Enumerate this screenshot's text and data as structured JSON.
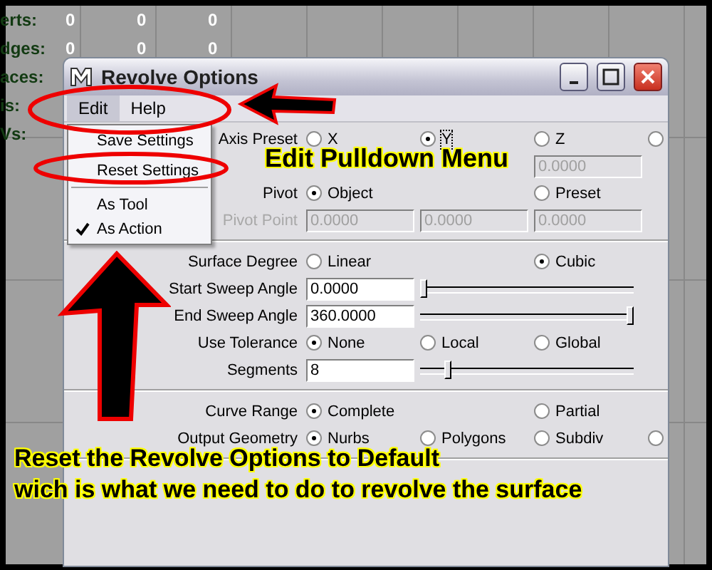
{
  "viewport_stats": [
    {
      "label": "erts:",
      "values": [
        "0",
        "0",
        "0"
      ]
    },
    {
      "label": "dges:",
      "values": [
        "0",
        "0",
        "0"
      ]
    },
    {
      "label": "aces:"
    },
    {
      "label": "is:"
    },
    {
      "label": "Vs:"
    }
  ],
  "window": {
    "title": "Revolve Options"
  },
  "menu_bar": [
    {
      "label": "Edit",
      "selected": true
    },
    {
      "label": "Help",
      "selected": false
    }
  ],
  "edit_menu": [
    {
      "kind": "item",
      "label": "Save Settings",
      "checked": false
    },
    {
      "kind": "item",
      "label": "Reset Settings",
      "checked": false
    },
    {
      "kind": "separator"
    },
    {
      "kind": "item",
      "label": "As Tool",
      "checked": false
    },
    {
      "kind": "item",
      "label": "As Action",
      "checked": true
    }
  ],
  "form": [
    {
      "kind": "radios",
      "label": "Axis Preset",
      "options": [
        {
          "kind": "radio",
          "label": "X",
          "selected": false,
          "focused": false
        },
        {
          "kind": "radio",
          "label": "Y",
          "selected": true,
          "focused": true
        },
        {
          "kind": "radio",
          "label": "Z",
          "selected": false,
          "focused": false
        },
        {
          "kind": "radio",
          "selected": false
        }
      ]
    },
    {
      "kind": "fields",
      "disabled": true,
      "fields": [
        {
          "kind": "gap"
        },
        {
          "kind": "gap"
        },
        {
          "kind": "field",
          "value": "0.0000"
        }
      ]
    },
    {
      "kind": "radios",
      "label": "Pivot",
      "options": [
        {
          "kind": "radio",
          "label": "Object",
          "selected": true,
          "focused": false
        },
        {
          "kind": "gap"
        },
        {
          "kind": "radio",
          "label": "Preset",
          "selected": false,
          "focused": false
        }
      ]
    },
    {
      "kind": "fields",
      "label": "Pivot Point",
      "disabled": true,
      "fields": [
        {
          "kind": "field",
          "value": "0.0000"
        },
        {
          "kind": "field",
          "value": "0.0000"
        },
        {
          "kind": "field",
          "value": "0.0000"
        }
      ]
    },
    {
      "kind": "separator"
    },
    {
      "kind": "radios",
      "label": "Surface Degree",
      "options": [
        {
          "kind": "radio",
          "label": "Linear",
          "selected": false,
          "focused": false
        },
        {
          "kind": "gap"
        },
        {
          "kind": "radio",
          "label": "Cubic",
          "selected": true,
          "focused": false
        }
      ]
    },
    {
      "kind": "slider",
      "label": "Start Sweep Angle",
      "value": "0.0000",
      "level": 0
    },
    {
      "kind": "slider",
      "label": "End Sweep Angle",
      "value": "360.0000",
      "level": 1
    },
    {
      "kind": "radios",
      "label": "Use Tolerance",
      "options": [
        {
          "kind": "radio",
          "label": "None",
          "selected": true,
          "focused": false
        },
        {
          "kind": "radio",
          "label": "Local",
          "selected": false,
          "focused": false
        },
        {
          "kind": "radio",
          "label": "Global",
          "selected": false,
          "focused": false
        }
      ]
    },
    {
      "kind": "slider",
      "label": "Segments",
      "value": "8",
      "level": 0.12
    },
    {
      "kind": "separator"
    },
    {
      "kind": "radios",
      "label": "Curve Range",
      "options": [
        {
          "kind": "radio",
          "label": "Complete",
          "selected": true,
          "focused": false
        },
        {
          "kind": "gap"
        },
        {
          "kind": "radio",
          "label": "Partial",
          "selected": false,
          "focused": false
        }
      ]
    },
    {
      "kind": "radios",
      "label": "Output Geometry",
      "options": [
        {
          "kind": "radio",
          "label": "Nurbs",
          "selected": true,
          "focused": false
        },
        {
          "kind": "radio",
          "label": "Polygons",
          "selected": false,
          "focused": false
        },
        {
          "kind": "radio",
          "label": "Subdiv",
          "selected": false,
          "focused": false
        },
        {
          "kind": "radio",
          "selected": false
        }
      ]
    },
    {
      "kind": "separator"
    }
  ],
  "annotations": {
    "menu_note": "Edit Pulldown Menu",
    "footer_note": [
      "Reset the Revolve Options to Default",
      "wich is what we need to do to revolve the surface"
    ]
  }
}
